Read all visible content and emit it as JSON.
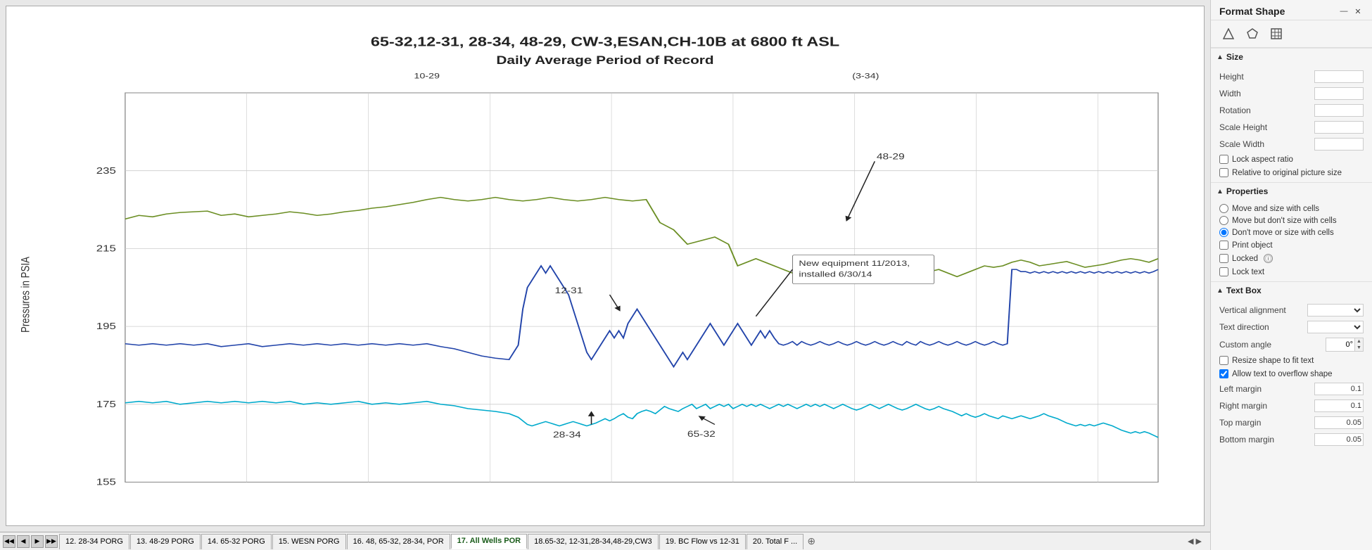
{
  "panel": {
    "title": "Format Shape",
    "icons": [
      "diamond",
      "pentagon",
      "table"
    ],
    "sections": {
      "size": {
        "label": "Size",
        "fields": [
          {
            "label": "Height",
            "value": ""
          },
          {
            "label": "Width",
            "value": ""
          },
          {
            "label": "Rotation",
            "value": ""
          },
          {
            "label": "Scale Height",
            "value": ""
          },
          {
            "label": "Scale Width",
            "value": ""
          }
        ],
        "checkboxes": [
          {
            "label": "Lock aspect ratio",
            "checked": false
          },
          {
            "label": "Relative to original picture size",
            "checked": false
          }
        ]
      },
      "properties": {
        "label": "Properties",
        "radios": [
          {
            "label": "Move and size with cells",
            "checked": false
          },
          {
            "label": "Move but don't size with cells",
            "checked": false
          },
          {
            "label": "Don't move or size with cells",
            "checked": true
          }
        ],
        "checkboxes": [
          {
            "label": "Print object",
            "checked": false
          },
          {
            "label": "Locked",
            "checked": false,
            "hasInfo": true
          },
          {
            "label": "Lock text",
            "checked": false
          }
        ]
      },
      "textbox": {
        "label": "Text Box",
        "fields": [
          {
            "label": "Vertical alignment",
            "type": "select",
            "value": ""
          },
          {
            "label": "Text direction",
            "type": "select",
            "value": ""
          },
          {
            "label": "Custom angle",
            "type": "angle",
            "value": "0°"
          }
        ],
        "checkboxes": [
          {
            "label": "Resize shape to fit text",
            "checked": false
          },
          {
            "label": "Allow text to overflow shape",
            "checked": true
          }
        ],
        "margins": [
          {
            "label": "Left margin",
            "value": "0.1"
          },
          {
            "label": "Right margin",
            "value": "0.1"
          },
          {
            "label": "Top margin",
            "value": "0.05"
          },
          {
            "label": "Bottom margin",
            "value": "0.05"
          }
        ]
      }
    }
  },
  "chart": {
    "title_line1": "65-32,12-31, 28-34, 48-29, CW-3,ESAN,CH-10B at 6800 ft ASL",
    "title_line2": "Daily Average Period of Record",
    "y_label": "Pressures in PSIA",
    "labels": {
      "well_48_29": "48-29",
      "well_12_31": "12-31",
      "well_28_34": "28-34",
      "well_65_32": "65-32",
      "annotation": "New equipment 11/2013, installed 6/30/14"
    },
    "y_ticks": [
      "235",
      "215",
      "195",
      "175",
      "155"
    ],
    "scrollbar_visible": true
  },
  "tabs": [
    {
      "label": "12. 28-34 PORG",
      "active": false
    },
    {
      "label": "13. 48-29 PORG",
      "active": false
    },
    {
      "label": "14. 65-32 PORG",
      "active": false
    },
    {
      "label": "15. WESN PORG",
      "active": false
    },
    {
      "label": "16. 48, 65-32, 28-34, POR",
      "active": false
    },
    {
      "label": "17. All Wells POR",
      "active": true
    },
    {
      "label": "18.65-32, 12-31,28-34,48-29,CW3",
      "active": false
    },
    {
      "label": "19. BC Flow vs 12-31",
      "active": false
    },
    {
      "label": "20. Total F ...",
      "active": false
    }
  ]
}
